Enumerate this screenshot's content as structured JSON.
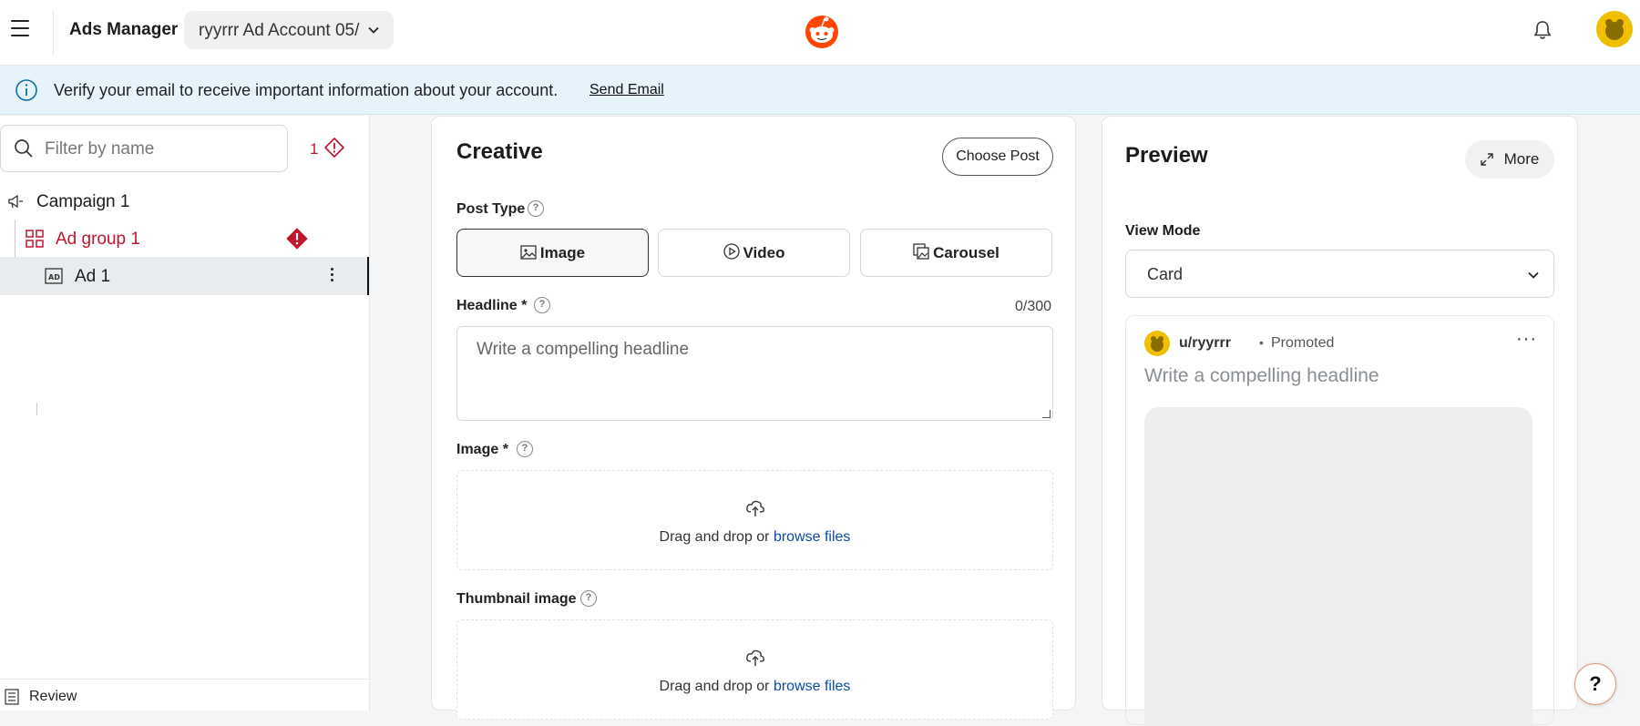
{
  "header": {
    "app_title": "Ads Manager",
    "account_selected": "ryyrrr Ad Account 05/"
  },
  "banner": {
    "message": "Verify your email to receive important information about your account.",
    "action": "Send Email"
  },
  "sidebar": {
    "filter_placeholder": "Filter by name",
    "error_count": "1",
    "tree": [
      {
        "label": "Campaign 1",
        "type": "campaign"
      },
      {
        "label": "Ad group 1",
        "type": "ad-group",
        "has_error": true
      },
      {
        "label": "Ad 1",
        "type": "ad",
        "selected": true
      }
    ],
    "review_label": "Review"
  },
  "creative": {
    "title": "Creative",
    "choose_post": "Choose Post",
    "post_type_label": "Post Type",
    "post_types": [
      {
        "label": "Image",
        "icon": "image-icon",
        "selected": true
      },
      {
        "label": "Video",
        "icon": "video-icon",
        "selected": false
      },
      {
        "label": "Carousel",
        "icon": "carousel-icon",
        "selected": false
      }
    ],
    "headline_label": "Headline *",
    "headline_counter": "0/300",
    "headline_placeholder": "Write a compelling headline",
    "image_label": "Image *",
    "image_drop_text": "Drag and drop or ",
    "image_browse": "browse files",
    "thumbnail_label": "Thumbnail image",
    "thumbnail_drop_text": "Drag and drop or ",
    "thumbnail_browse": "browse files"
  },
  "preview": {
    "title": "Preview",
    "more": "More",
    "view_mode_label": "View Mode",
    "view_mode_value": "Card",
    "post_user": "u/ryyrrr",
    "post_separator": "•",
    "post_promoted": "Promoted",
    "post_headline": "Write a compelling headline"
  },
  "help_fab": "?",
  "colors": {
    "brand": "#ff4500",
    "error": "#c0152e",
    "link": "#0a4da8",
    "banner_bg": "#e6f3fb"
  }
}
